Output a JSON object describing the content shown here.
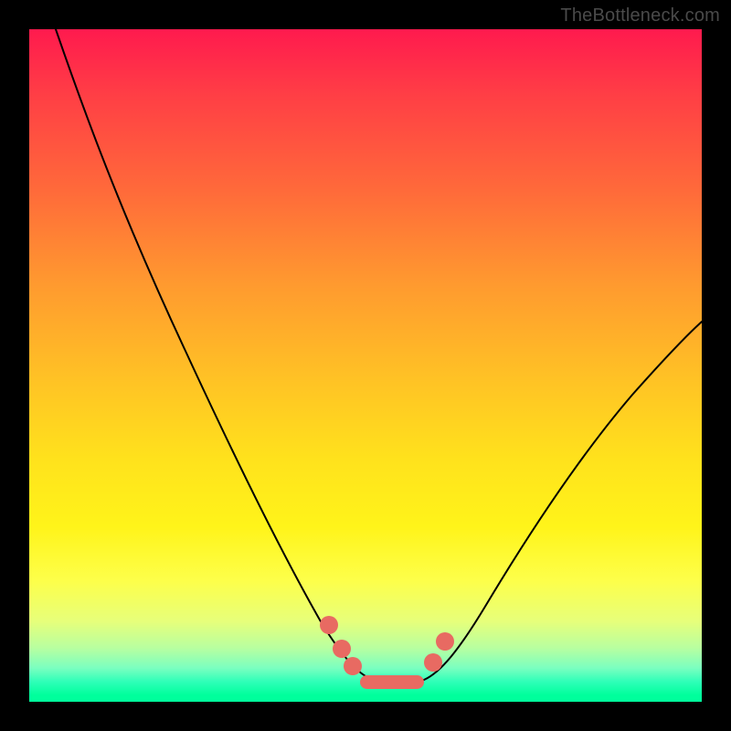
{
  "attribution": "TheBottleneck.com",
  "colors": {
    "gradient_top": "#ff1a4e",
    "gradient_bottom": "#00ff9c",
    "frame": "#000000",
    "curve": "#000000",
    "marker": "#e86a62"
  },
  "chart_data": {
    "type": "line",
    "title": "",
    "xlabel": "",
    "ylabel": "",
    "xlim": [
      0,
      100
    ],
    "ylim": [
      0,
      100
    ],
    "grid": false,
    "series": [
      {
        "name": "bottleneck-curve",
        "x": [
          4,
          10,
          18,
          26,
          34,
          40,
          44,
          47,
          49.5,
          52,
          55,
          60,
          66,
          74,
          82,
          90,
          100
        ],
        "y": [
          100,
          84,
          67,
          50,
          32,
          19,
          11,
          6,
          3.5,
          3,
          3.5,
          6,
          13,
          25,
          38,
          48,
          58
        ]
      }
    ],
    "markers": [
      {
        "shape": "dot",
        "x": 44.5,
        "y": 11.5,
        "r": 1.3
      },
      {
        "shape": "dot",
        "x": 46.5,
        "y": 8.0,
        "r": 1.3
      },
      {
        "shape": "dot",
        "x": 48.0,
        "y": 5.3,
        "r": 1.3
      },
      {
        "shape": "dot",
        "x": 60.0,
        "y": 5.8,
        "r": 1.3
      },
      {
        "shape": "dot",
        "x": 62.0,
        "y": 9.0,
        "r": 1.3
      },
      {
        "shape": "bar",
        "x0": 49.5,
        "x1": 58.5,
        "y": 3.0,
        "h": 2.0
      }
    ],
    "nadir": {
      "x": 54,
      "y": 3
    }
  }
}
